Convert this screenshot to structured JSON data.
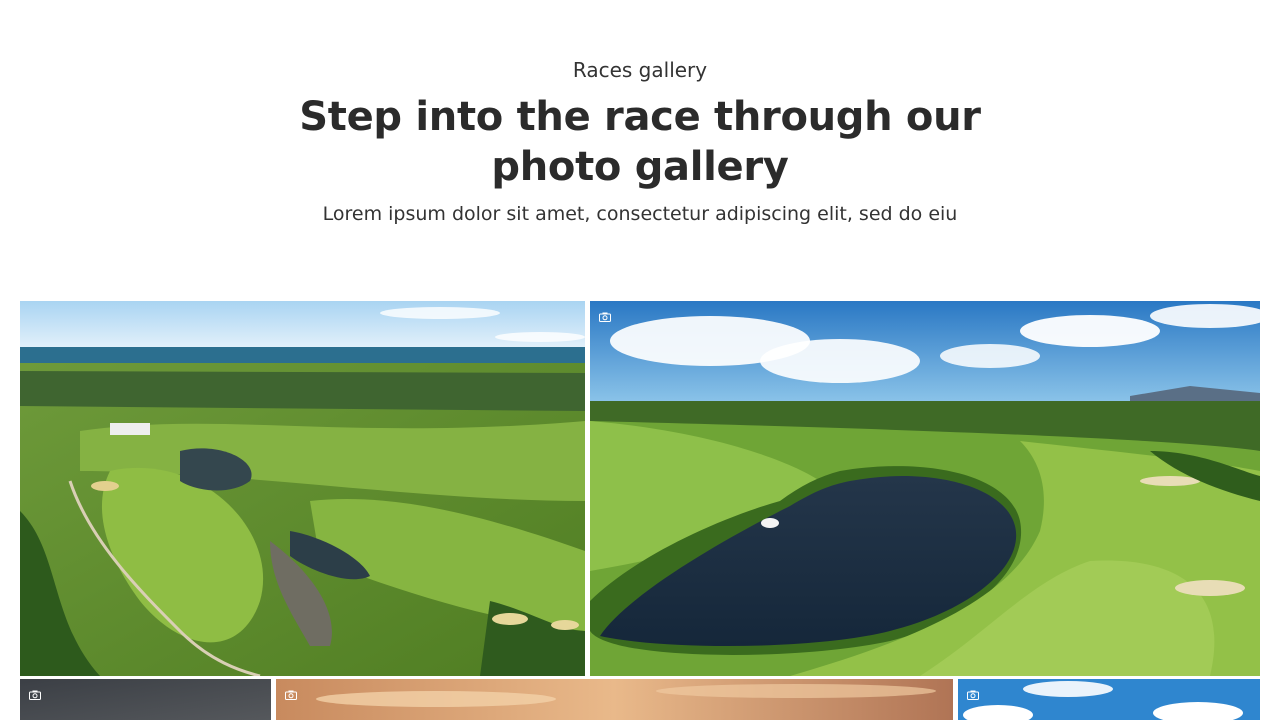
{
  "gallery": {
    "eyebrow": "Races gallery",
    "title": "Step into the race through our photo gallery",
    "subtitle": "Lorem ipsum dolor sit amet, consectetur adipiscing elit, sed do eiu"
  },
  "photos": [
    {
      "subject": "aerial golf course by the ocean",
      "icon": "camera-icon"
    },
    {
      "subject": "aerial golf course with lake and fountain",
      "icon": "camera-icon"
    },
    {
      "subject": "dark sky",
      "icon": "camera-icon"
    },
    {
      "subject": "sunset sky",
      "icon": "camera-icon"
    },
    {
      "subject": "blue sky with clouds",
      "icon": "camera-icon"
    }
  ]
}
